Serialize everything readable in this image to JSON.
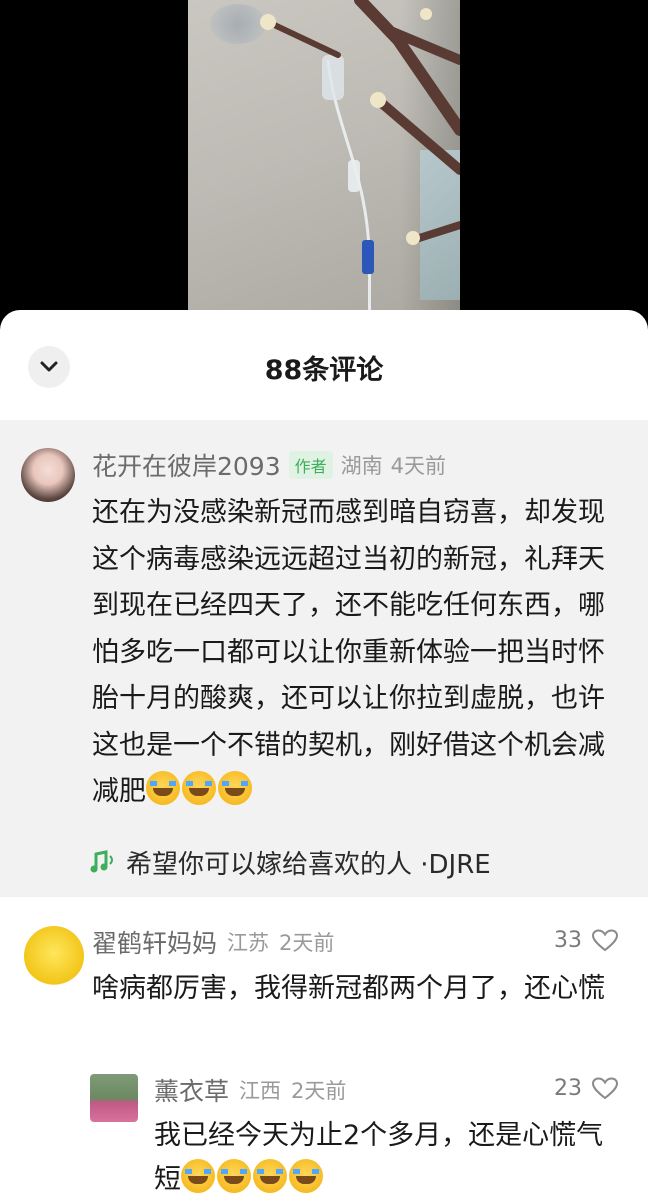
{
  "video": {
    "description_icon": "video-frame"
  },
  "sheet": {
    "title": "88条评论",
    "collapse_icon": "chevron-down-icon"
  },
  "comments": [
    {
      "username": "花开在彼岸2093",
      "badge": "作者",
      "location": "湖南",
      "time": "4天前",
      "text": "还在为没感染新冠而感到暗自窃喜，却发现这个病毒感染远远超过当初的新冠，礼拜天到现在已经四天了，还不能吃任何东西，哪怕多吃一口都可以让你重新体验一把当时怀胎十月的酸爽，还可以让你拉到虚脱，也许这也是一个不错的契机，刚好借这个机会减减肥",
      "emojis": 3,
      "music": "希望你可以嫁给喜欢的人 ·DJRE"
    },
    {
      "username": "翟鹤轩妈妈",
      "location": "江苏",
      "time": "2天前",
      "likes": "33",
      "text": "啥病都厉害，我得新冠都两个月了，还心慌"
    },
    {
      "username": "薰衣草",
      "location": "江西",
      "time": "2天前",
      "likes": "23",
      "text": "我已经今天为止2个多月，还是心慌气短",
      "emojis": 4
    }
  ],
  "colors": {
    "accent_green": "#3fae5c",
    "featured_bg": "#f2f2f2",
    "meta_gray": "#9a9a9a"
  }
}
